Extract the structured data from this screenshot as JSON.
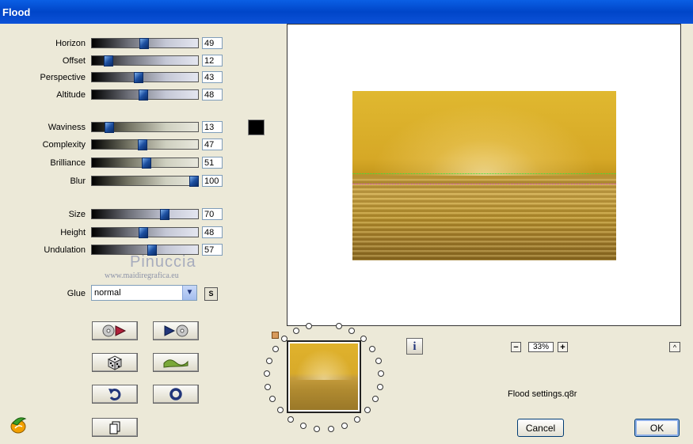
{
  "window": {
    "title": "Flood"
  },
  "sliders_group1": [
    {
      "label": "Horizon",
      "value": "49",
      "fraction": 0.49
    },
    {
      "label": "Offset",
      "value": "12",
      "fraction": 0.12
    },
    {
      "label": "Perspective",
      "value": "43",
      "fraction": 0.43
    },
    {
      "label": "Altitude",
      "value": "48",
      "fraction": 0.48
    }
  ],
  "sliders_group2": [
    {
      "label": "Waviness",
      "value": "13",
      "fraction": 0.13
    },
    {
      "label": "Complexity",
      "value": "47",
      "fraction": 0.47
    },
    {
      "label": "Brilliance",
      "value": "51",
      "fraction": 0.51
    },
    {
      "label": "Blur",
      "value": "100",
      "fraction": 1.0
    }
  ],
  "sliders_group3": [
    {
      "label": "Size",
      "value": "70",
      "fraction": 0.7
    },
    {
      "label": "Height",
      "value": "48",
      "fraction": 0.48
    },
    {
      "label": "Undulation",
      "value": "57",
      "fraction": 0.57
    }
  ],
  "color_swatch": "#000000",
  "watermark": {
    "name": "Pinuccia",
    "url": "www.maidiregrafica.eu"
  },
  "glue": {
    "label": "Glue",
    "selected": "normal",
    "side_button": "S"
  },
  "zoom": {
    "minus": "−",
    "value": "33%",
    "plus": "+"
  },
  "info_button": "i",
  "settings_file": "Flood settings.q8r",
  "buttons": {
    "cancel": "Cancel",
    "ok": "OK"
  },
  "up_button": "^"
}
